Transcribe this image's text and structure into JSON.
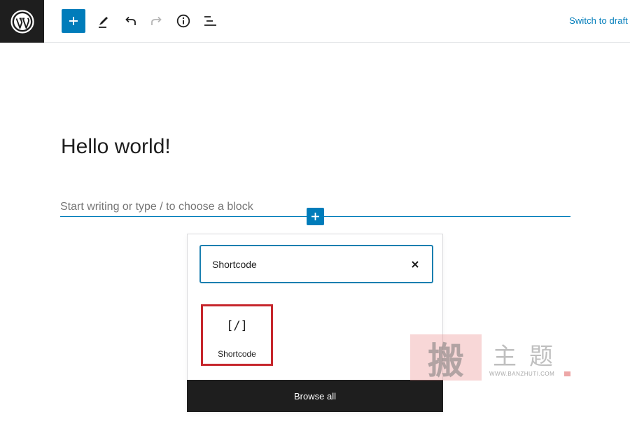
{
  "toolbar": {
    "logo_icon": "wordpress-logo",
    "add_block_icon": "plus-icon",
    "tools_icon": "pencil-icon",
    "undo_icon": "undo-icon",
    "redo_icon": "redo-icon",
    "details_icon": "info-icon",
    "list_view_icon": "list-view-icon",
    "switch_to_draft_label": "Switch to draft",
    "accent_color": "#007cba"
  },
  "editor": {
    "post_title": "Hello world!",
    "block_placeholder": "Start writing or type / to choose a block",
    "inline_add_icon": "plus-icon"
  },
  "inserter": {
    "search_value": "Shortcode",
    "clear_icon": "close-icon",
    "results": [
      {
        "icon_text": "[/]",
        "label": "Shortcode"
      }
    ],
    "browse_all_label": "Browse all",
    "highlight_color": "#c6262c"
  },
  "watermark": {
    "stamp": "搬",
    "text": "主题",
    "url": "WWW.BANZHUTI.COM"
  }
}
